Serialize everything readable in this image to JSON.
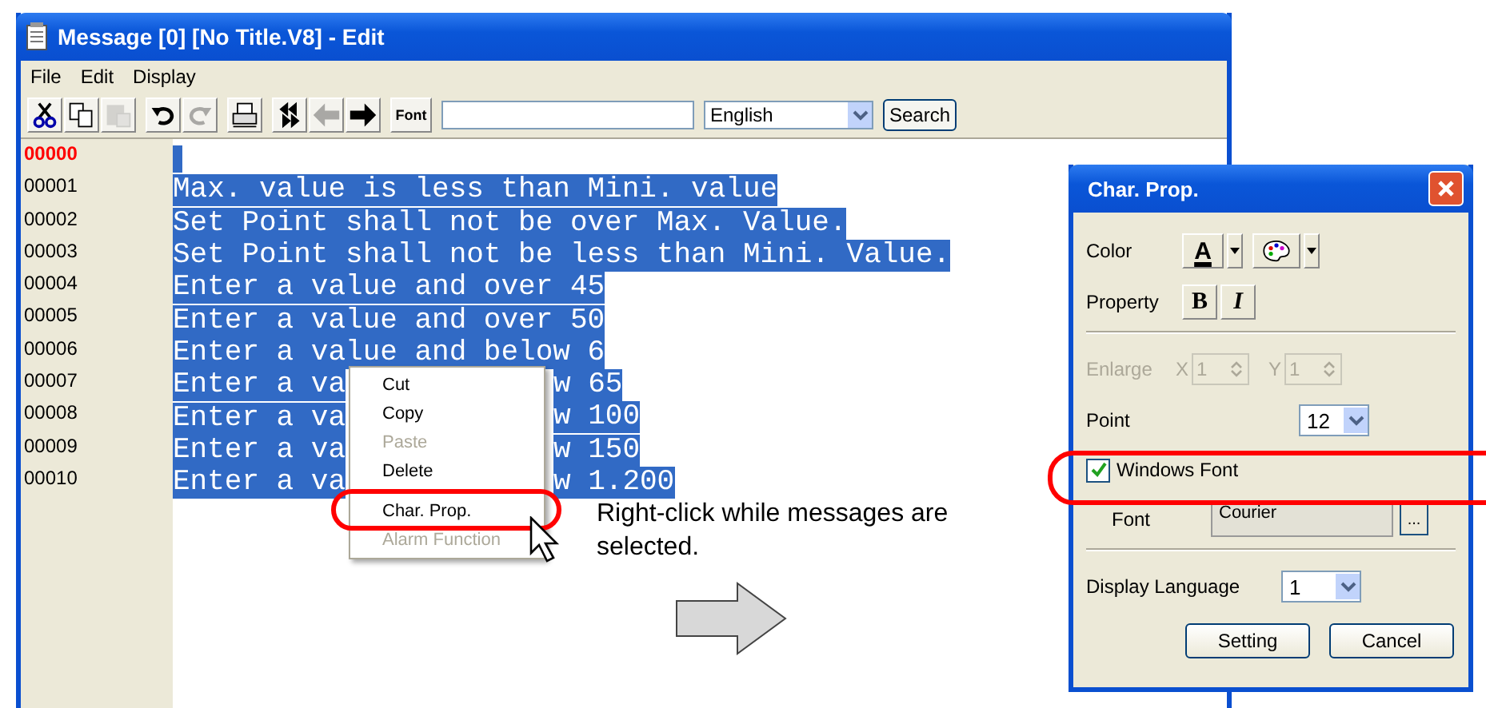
{
  "window": {
    "title": "Message [0] [No Title.V8] - Edit"
  },
  "menu_bar": [
    "File",
    "Edit",
    "Display"
  ],
  "toolbar": {
    "groups": [
      [
        {
          "kind": "cut",
          "disabled": false
        },
        {
          "kind": "copy",
          "disabled": false
        },
        {
          "kind": "paste",
          "disabled": true
        }
      ],
      [
        {
          "kind": "undo",
          "disabled": false
        },
        {
          "kind": "redo",
          "disabled": true
        }
      ],
      [
        {
          "kind": "print",
          "disabled": false
        }
      ],
      [
        {
          "kind": "jump",
          "disabled": false
        },
        {
          "kind": "prev",
          "disabled": true
        },
        {
          "kind": "next",
          "disabled": false
        }
      ]
    ],
    "font_button": "Font",
    "language": "English",
    "search_button": "Search"
  },
  "messages": [
    {
      "number": "00000",
      "current": true
    },
    {
      "number": "00001",
      "current": false,
      "selected": true,
      "text": "Max. value is less than Mini. value"
    },
    {
      "number": "00002",
      "current": false,
      "selected": true,
      "text": "Set Point shall not be over Max. Value."
    },
    {
      "number": "00003",
      "current": false,
      "selected": true,
      "text": "Set Point shall not be less than Mini. Value."
    },
    {
      "number": "00004",
      "current": false,
      "selected": true,
      "text": "Enter a value and over 45"
    },
    {
      "number": "00005",
      "current": false,
      "selected": true,
      "text": "Enter a value and over 50"
    },
    {
      "number": "00006",
      "current": false,
      "selected": true,
      "text": "Enter a value and below 6"
    },
    {
      "number": "00007",
      "current": false,
      "selected": true,
      "text": "Enter a va",
      "tail": "w 65"
    },
    {
      "number": "00008",
      "current": false,
      "selected": true,
      "text": "Enter a va",
      "tail": "w 100"
    },
    {
      "number": "00009",
      "current": false,
      "selected": true,
      "text": "Enter a va",
      "tail": "w 150"
    },
    {
      "number": "00010",
      "current": false,
      "selected": true,
      "text": "Enter a va",
      "tail": "w 1.200"
    }
  ],
  "context_menu": [
    {
      "kind": "item",
      "label": "Cut",
      "disabled": false,
      "circled": false
    },
    {
      "kind": "item",
      "label": "Copy",
      "disabled": false,
      "circled": false
    },
    {
      "kind": "item",
      "label": "Paste",
      "disabled": true,
      "circled": false
    },
    {
      "kind": "item",
      "label": "Delete",
      "disabled": false,
      "circled": false
    },
    {
      "kind": "separator"
    },
    {
      "kind": "item",
      "label": "Char. Prop.",
      "disabled": false,
      "circled": true
    },
    {
      "kind": "item",
      "label": "Alarm Function",
      "disabled": true,
      "circled": false
    }
  ],
  "annotation": "Right-click while messages are selected.",
  "dialog": {
    "title": "Char. Prop.",
    "color_label": "Color",
    "color_button": "A",
    "property_label": "Property",
    "bold_button": "B",
    "italic_button": "I",
    "enlarge": {
      "label": "Enlarge",
      "disabled": true,
      "x_label": "X",
      "x_value": "1",
      "y_label": "Y",
      "y_value": "1"
    },
    "point": {
      "label": "Point",
      "value": "12"
    },
    "windows_font": {
      "label": "Windows Font",
      "checked": true,
      "circled": true
    },
    "font": {
      "label": "Font",
      "value": "Courier",
      "browse": "..."
    },
    "display_language": {
      "label": "Display Language",
      "value": "1"
    },
    "buttons": [
      "Setting",
      "Cancel"
    ]
  }
}
